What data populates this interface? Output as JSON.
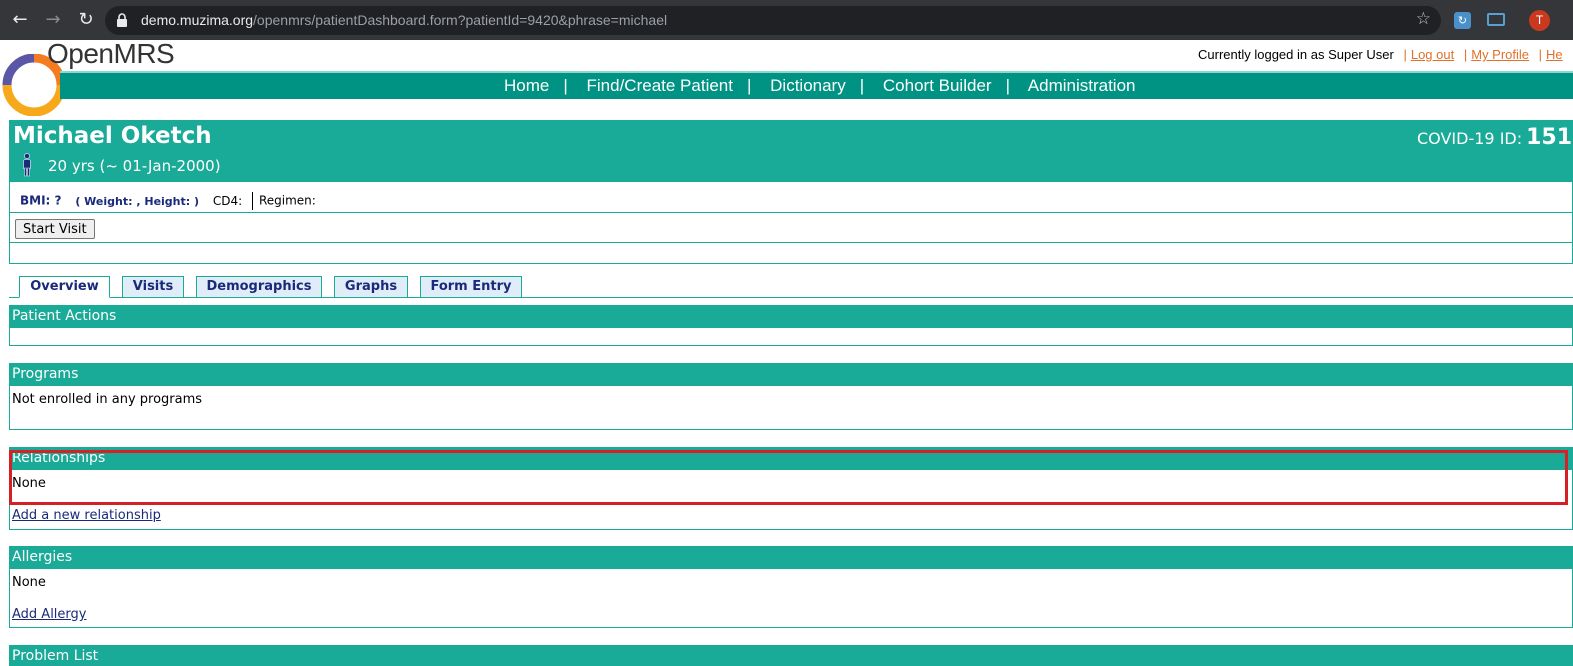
{
  "browser": {
    "url_host": "demo.muzima.org",
    "url_path": "/openmrs/patientDashboard.form?patientId=9420&phrase=michael",
    "avatar_letter": "T"
  },
  "header": {
    "brand": "OpenMRS",
    "logged_in_text": "Currently logged in as Super User",
    "logout": "Log out",
    "profile": "My Profile",
    "help": "He"
  },
  "nav": {
    "items": [
      "Home",
      "Find/Create Patient",
      "Dictionary",
      "Cohort Builder",
      "Administration"
    ]
  },
  "patient": {
    "name": "Michael Oketch",
    "age": "20 yrs (~ 01-Jan-2000)",
    "id_label": "COVID-19 ID:",
    "id_value": "151",
    "bmi": "BMI: ?",
    "weight_height": "( Weight: , Height: )",
    "cd4": "CD4:",
    "regimen": "Regimen:",
    "start_visit": "Start Visit"
  },
  "tabs": [
    "Overview",
    "Visits",
    "Demographics",
    "Graphs",
    "Form Entry"
  ],
  "sections": {
    "patient_actions": "Patient Actions",
    "programs": "Programs",
    "programs_text": "Not enrolled in any programs",
    "relationships": "Relationships",
    "relationships_text": "None",
    "add_relationship": "Add a new relationship",
    "allergies": "Allergies",
    "allergies_text": "None",
    "add_allergy": "Add Allergy",
    "problem_list": "Problem List"
  },
  "colors": {
    "teal": "#1aaa98",
    "nav_teal": "#009384",
    "link_orange": "#e0712a",
    "highlight_red": "#d61f26"
  }
}
